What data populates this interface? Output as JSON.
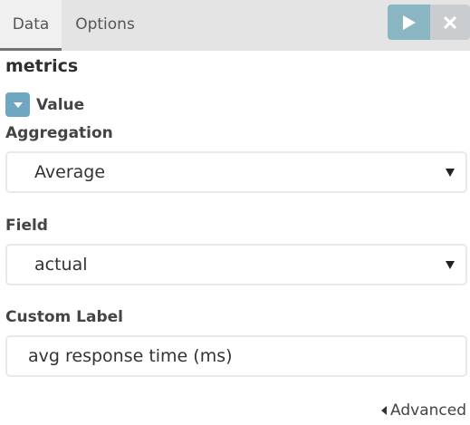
{
  "tabs": [
    {
      "label": "Data",
      "active": true
    },
    {
      "label": "Options",
      "active": false
    }
  ],
  "toolbar": {
    "apply_icon": "play-icon",
    "close_icon": "close-icon",
    "accent_color": "#8ab5c3"
  },
  "section": {
    "title": "metrics"
  },
  "metric": {
    "name": "Value",
    "toggle_icon": "caret-down-icon"
  },
  "aggregation": {
    "label": "Aggregation",
    "value": "Average"
  },
  "field": {
    "label": "Field",
    "value": "actual"
  },
  "custom_label": {
    "label": "Custom Label",
    "value": "avg response time (ms)"
  },
  "advanced": {
    "label": "Advanced",
    "icon": "caret-left-icon"
  }
}
